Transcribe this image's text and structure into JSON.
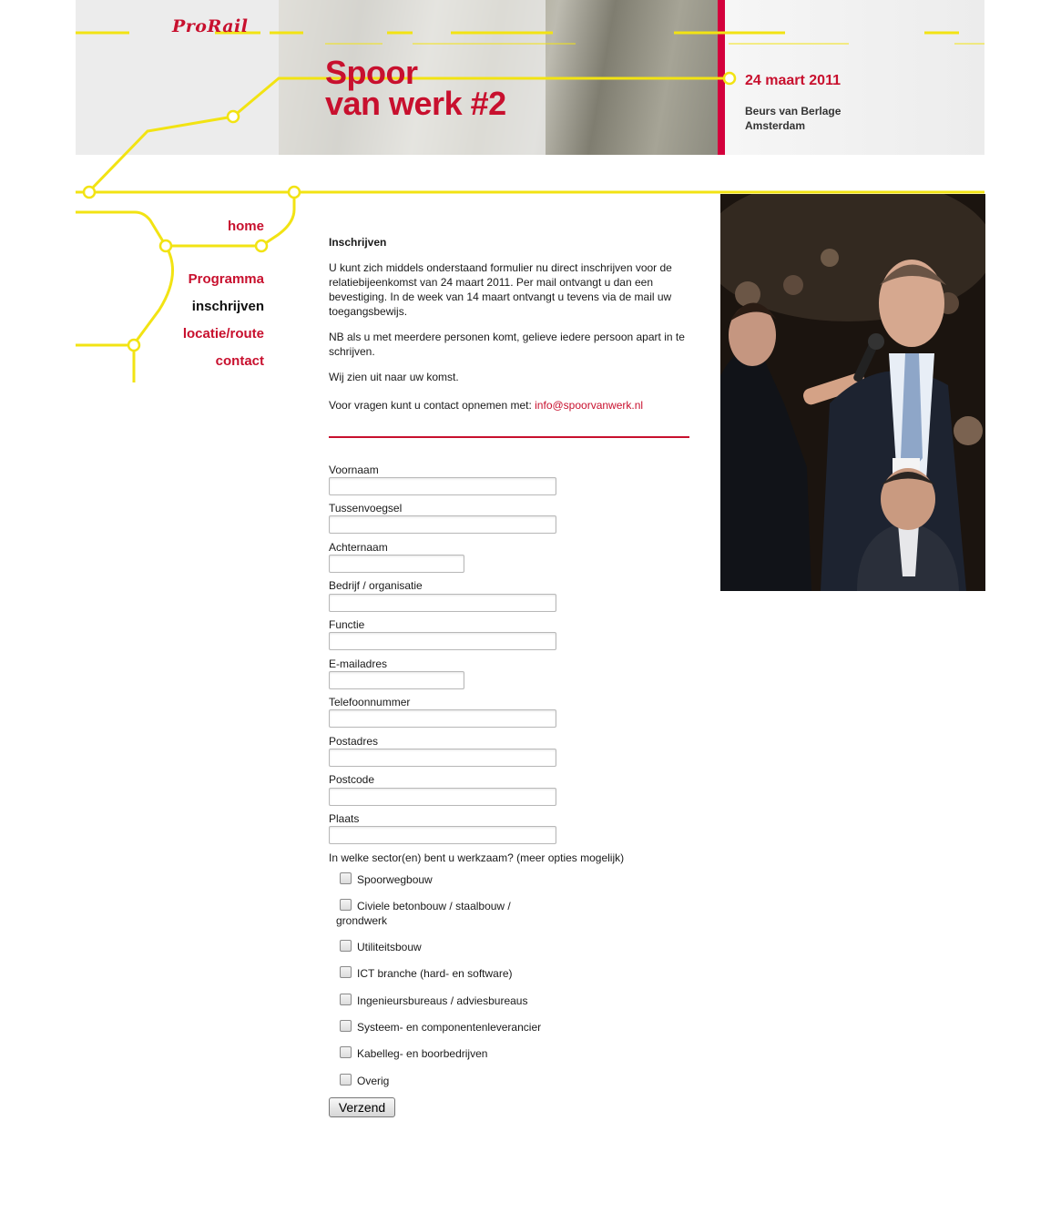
{
  "header": {
    "logo": "ProRail",
    "title_line1": "Spoor",
    "title_line2": "van werk #2",
    "date": "24 maart 2011",
    "venue_line1": "Beurs van Berlage",
    "venue_line2": "Amsterdam"
  },
  "colors": {
    "brand_red": "#c8102e",
    "track_yellow": "#f2e313",
    "header_bar_red": "#d4003c"
  },
  "nav": {
    "home": "home",
    "programma": "Programma",
    "inschrijven": "inschrijven",
    "locatie": "locatie/route",
    "contact": "contact"
  },
  "content": {
    "heading": "Inschrijven",
    "para1": "U kunt zich middels onderstaand formulier nu direct inschrijven voor de relatiebijeenkomst van 24 maart 2011. Per mail ontvangt u dan een bevestiging. In de week van 14 maart ontvangt u tevens via de mail uw toegangsbewijs.",
    "para2": "NB als u met meerdere personen komt, gelieve iedere persoon apart in te schrijven.",
    "para3": "Wij zien uit naar uw komst.",
    "contact_prefix": "Voor vragen kunt u contact opnemen met: ",
    "contact_email": "info@spoorvanwerk.nl"
  },
  "form": {
    "voornaam": {
      "label": "Voornaam",
      "value": ""
    },
    "tussenvoegsel": {
      "label": "Tussenvoegsel",
      "value": ""
    },
    "achternaam": {
      "label": "Achternaam",
      "value": ""
    },
    "bedrijf": {
      "label": "Bedrijf / organisatie",
      "value": ""
    },
    "functie": {
      "label": "Functie",
      "value": ""
    },
    "email": {
      "label": "E-mailadres",
      "value": ""
    },
    "telefoon": {
      "label": "Telefoonnummer",
      "value": ""
    },
    "postadres": {
      "label": "Postadres",
      "value": ""
    },
    "postcode": {
      "label": "Postcode",
      "value": ""
    },
    "plaats": {
      "label": "Plaats",
      "value": ""
    },
    "sector_question": "In welke sector(en) bent u werkzaam? (meer opties mogelijk)",
    "sectors": {
      "spoorwegbouw": {
        "label": "Spoorwegbouw",
        "checked": false
      },
      "civiele_1": "Civiele betonbouw / staalbouw /",
      "civiele_2": "grondwerk",
      "civiele_checked": false,
      "utiliteitsbouw": {
        "label": "Utiliteitsbouw",
        "checked": false
      },
      "ict": {
        "label": "ICT branche (hard- en software)",
        "checked": false
      },
      "ingenieurs": {
        "label": "Ingenieursbureaus / adviesbureaus",
        "checked": false
      },
      "systeem": {
        "label": "Systeem- en componentenleverancier",
        "checked": false
      },
      "kabel": {
        "label": "Kabelleg- en boorbedrijven",
        "checked": false
      },
      "overig": {
        "label": "Overig",
        "checked": false
      }
    },
    "submit_label": "Verzend"
  },
  "icons": [
    "track-line-graphic",
    "track-station-dot-icon"
  ]
}
